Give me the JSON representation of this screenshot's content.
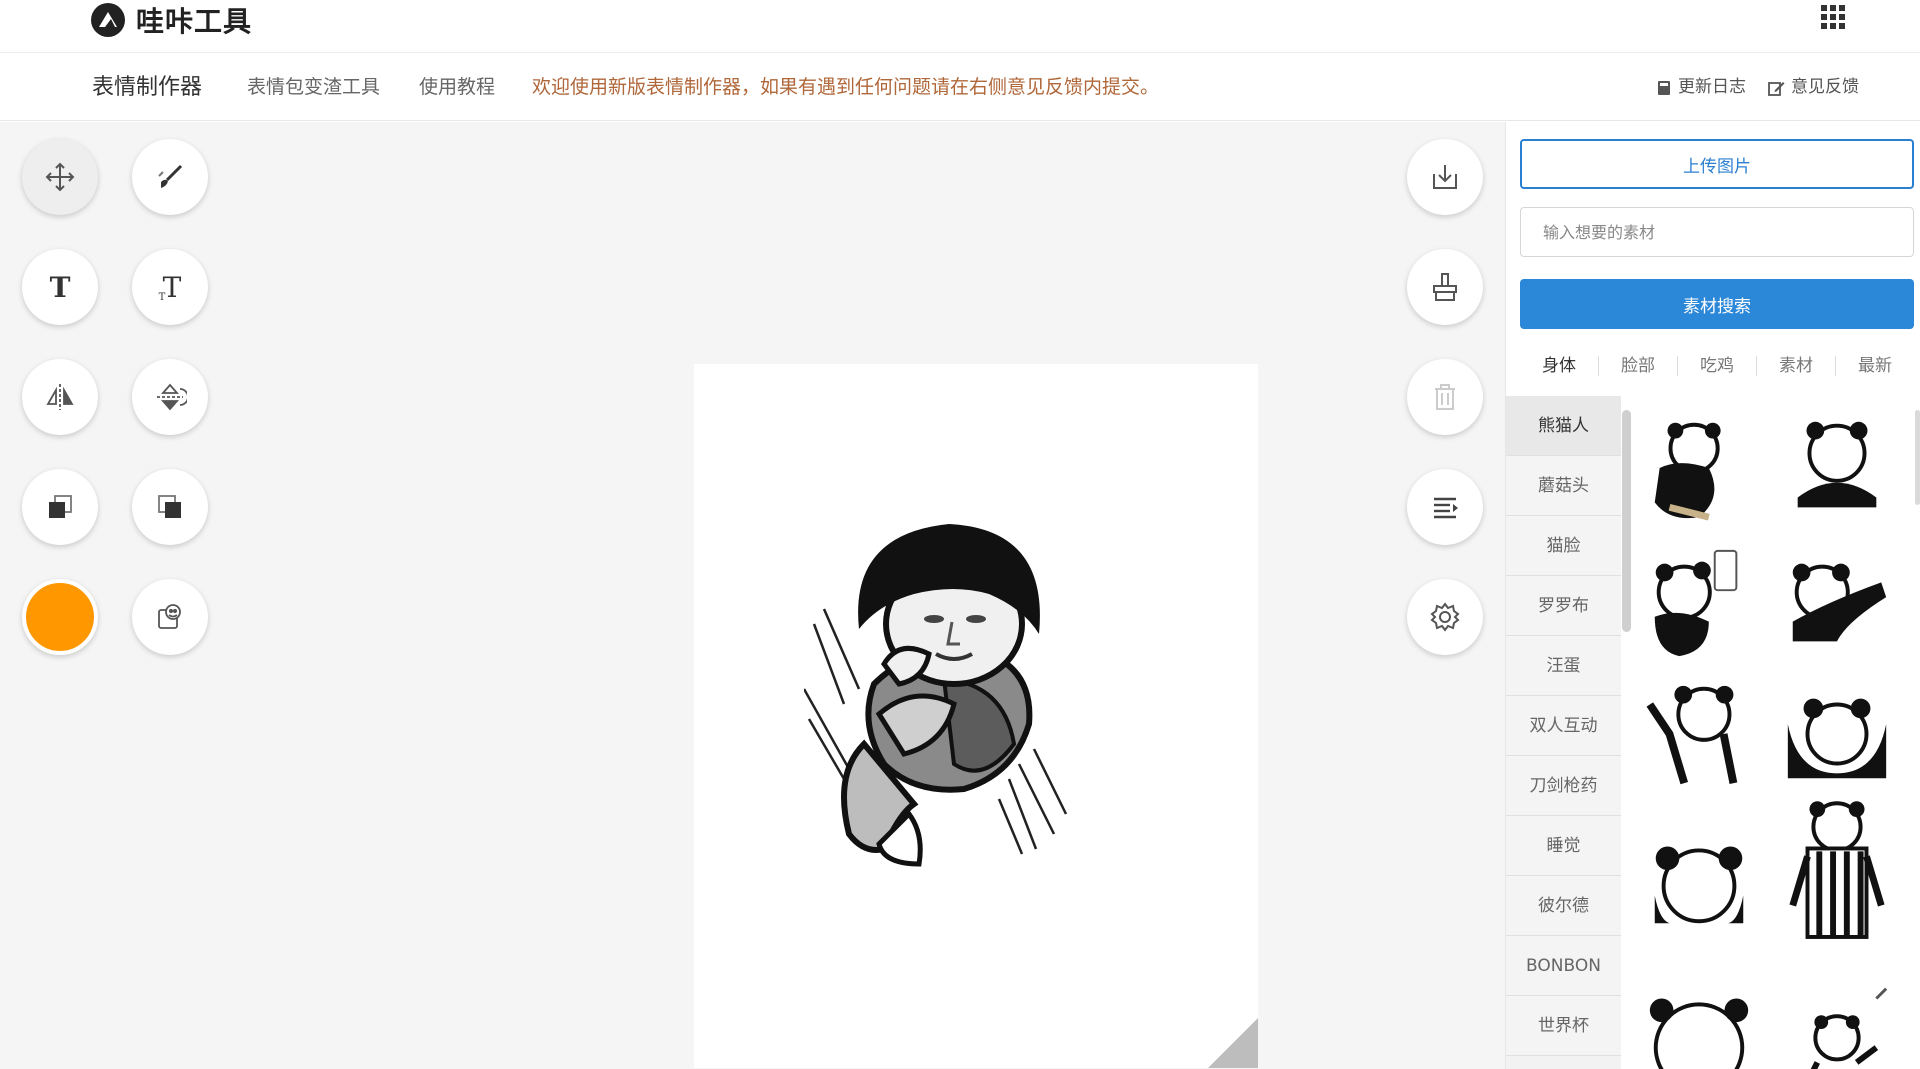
{
  "header": {
    "logo_text": "哇咔工具",
    "apps_icon": "grid-apps-icon"
  },
  "subnav": {
    "title": "表情制作器",
    "links": [
      "表情包变渣工具",
      "使用教程"
    ],
    "notice": "欢迎使用新版表情制作器，如果有遇到任何问题请在右侧意见反馈内提交。",
    "changelog": "更新日志",
    "feedback": "意见反馈"
  },
  "tools": {
    "left": [
      "move-icon",
      "brush-icon",
      "text-icon",
      "vertical-text-icon",
      "flip-horizontal-icon",
      "flip-vertical-icon",
      "bring-forward-icon",
      "send-backward-icon",
      "color-picker",
      "sticker-add-icon"
    ],
    "right": [
      "download-icon",
      "clear-icon",
      "delete-icon",
      "align-icon",
      "settings-icon"
    ]
  },
  "colors": {
    "brush": "#ff9800",
    "accent": "#2b87d8",
    "notice": "#b0673a"
  },
  "panel": {
    "upload_label": "上传图片",
    "search_placeholder": "输入想要的素材",
    "search_button": "素材搜索",
    "tabs": [
      "身体",
      "脸部",
      "吃鸡",
      "素材",
      "最新"
    ],
    "subcategories": [
      "熊猫人",
      "蘑菇头",
      "猫脸",
      "罗罗布",
      "汪蛋",
      "双人互动",
      "刀剑枪药",
      "睡觉",
      "彼尔德",
      "BONBON",
      "世界杯"
    ]
  }
}
